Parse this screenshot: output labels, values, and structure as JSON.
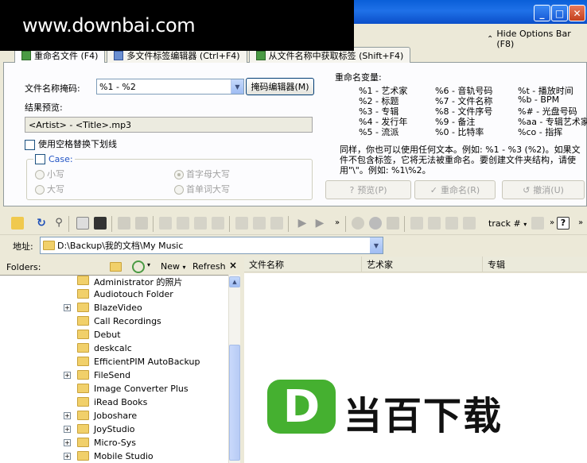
{
  "watermark": "www.downbai.com",
  "hide_options": "Hide Options Bar (F8)",
  "tabs": [
    {
      "label": "重命名文件 (F4)"
    },
    {
      "label": "多文件标签编辑器 (Ctrl+F4)"
    },
    {
      "label": "从文件名称中获取标签 (Shift+F4)"
    }
  ],
  "rename": {
    "mask_label": "文件名称掩码:",
    "mask_value": "%1 - %2",
    "mask_editor": "掩码编辑器(M)",
    "preview_label": "结果预览:",
    "preview_value": "<Artist> - <Title>.mp3",
    "replace_spaces": "使用空格替换下划线",
    "case_title": "Case:",
    "lower": "小写",
    "upper": "大写",
    "first_upper": "首字母大写",
    "word_upper": "首单词大写"
  },
  "vars": {
    "title": "重命名变量:",
    "items": [
      "%1 - 艺术家",
      "%2 - 标题",
      "%3 - 专辑",
      "%4 - 发行年",
      "%5 - 流派",
      "%6 - 音轨号码",
      "%7 - 文件名称",
      "%8 - 文件序号",
      "%9 - 备注",
      "%0 - 比特率",
      "%t - 播放时间",
      "%b - BPM",
      "%# - 光盘号码",
      "%aa - 专辑艺术家",
      "%co - 指挥"
    ],
    "note1": "同样，你也可以使用任何文本。例如: %1 - %3 (%2)。如果文",
    "note2": "件不包含标签，它将无法被重命名。要创建文件夹结构，请使",
    "note3": "用\"\\\"。例如: %1\\%2。"
  },
  "actions": {
    "preview": "预览(P)",
    "rename": "重命名(R)",
    "undo": "撤消(U)"
  },
  "toolbar": {
    "track_label": "track #"
  },
  "address": {
    "label": "地址:",
    "value": "D:\\Backup\\我的文档\\My Music"
  },
  "folders": {
    "title": "Folders:",
    "new": "New",
    "refresh": "Refresh",
    "items": [
      {
        "name": "Administrator 的照片"
      },
      {
        "name": "Audiotouch Folder"
      },
      {
        "name": "BlazeVideo"
      },
      {
        "name": "Call Recordings"
      },
      {
        "name": "Debut"
      },
      {
        "name": "deskcalc"
      },
      {
        "name": "EfficientPIM AutoBackup"
      },
      {
        "name": "FileSend"
      },
      {
        "name": "Image Converter Plus"
      },
      {
        "name": "iRead Books"
      },
      {
        "name": "Joboshare"
      },
      {
        "name": "JoyStudio"
      },
      {
        "name": "Micro-Sys"
      },
      {
        "name": "Mobile Studio"
      }
    ]
  },
  "columns": [
    "文件名称",
    "艺术家",
    "专辑"
  ],
  "logo": {
    "letter": "D",
    "text": "当百下载"
  }
}
